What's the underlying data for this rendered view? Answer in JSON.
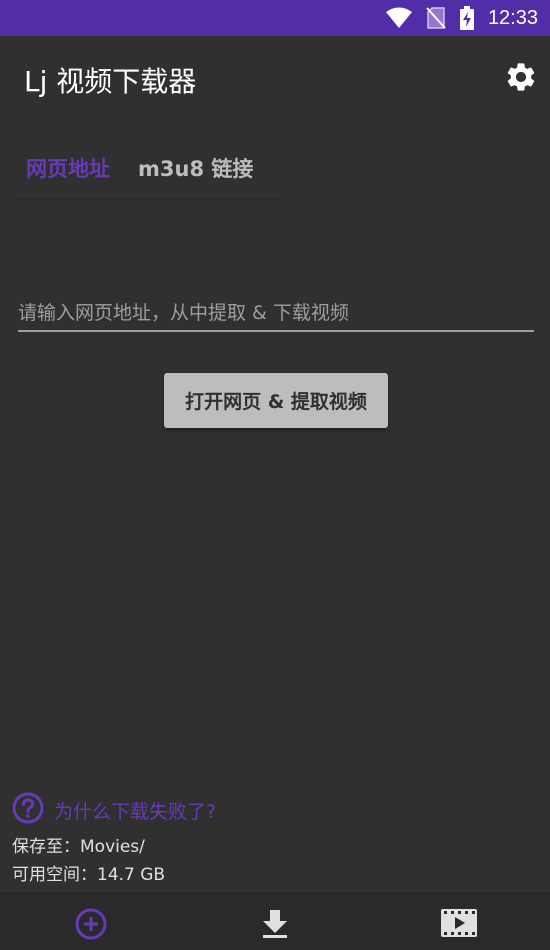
{
  "status_bar": {
    "time": "12:33"
  },
  "app_bar": {
    "title": "Lj 视频下载器"
  },
  "tabs": [
    {
      "label": "网页地址",
      "active": true
    },
    {
      "label": "m3u8 链接",
      "active": false
    }
  ],
  "url_input": {
    "placeholder": "请输入网页地址，从中提取 & 下载视频",
    "value": ""
  },
  "open_button": {
    "label": "打开网页 & 提取视频"
  },
  "help": {
    "label": "为什么下载失败了?"
  },
  "save_to": {
    "label": "保存至：Movies/"
  },
  "free_space": {
    "label": "可用空间：14.7 GB"
  },
  "colors": {
    "accent": "#673ab7",
    "status_bar": "#512da8",
    "background": "#303030"
  },
  "icons": [
    "wifi-icon",
    "no-sim-icon",
    "battery-charging-icon",
    "gear-icon",
    "help-circle-icon",
    "add-circle-icon",
    "download-icon",
    "video-icon"
  ]
}
